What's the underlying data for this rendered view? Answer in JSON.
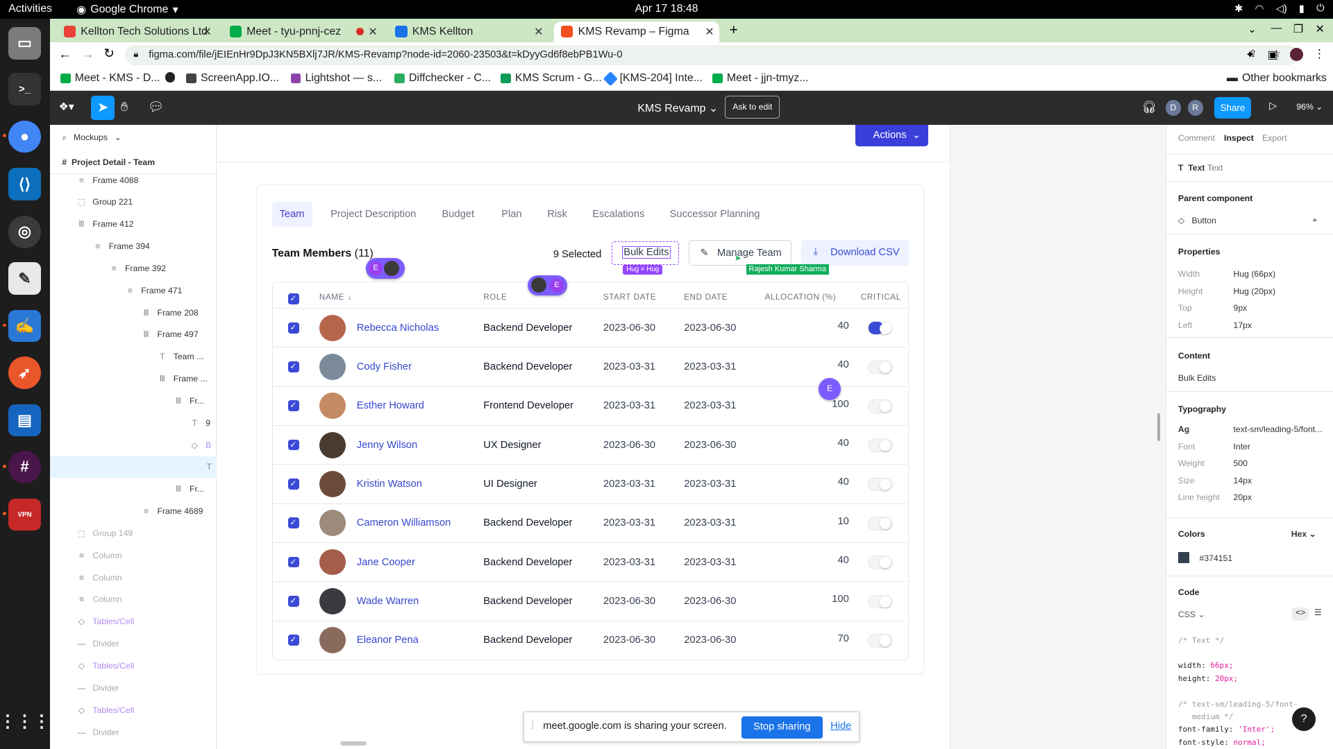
{
  "os": {
    "activities": "Activities",
    "app_name": "Google Chrome",
    "clock": "Apr 17  18:48"
  },
  "chrome": {
    "tabs": [
      {
        "title": "Kellton Tech Solutions Ltd",
        "fav": "#ea4335"
      },
      {
        "title": "Meet - tyu-pnnj-cez",
        "fav": "#00ac47"
      },
      {
        "title": "KMS Kellton",
        "fav": "#1a73e8"
      },
      {
        "title": "KMS Revamp – Figma",
        "fav": "#f24e1e"
      }
    ],
    "url": "figma.com/file/jEIEnHr9DpJ3KN5BXlj7JR/KMS-Revamp?node-id=2060-23503&t=kDyyGd6f8ebPB1Wu-0",
    "bookmarks": [
      {
        "label": "Meet - KMS - D...",
        "color": "#00ac47"
      },
      {
        "label": "",
        "color": "#222"
      },
      {
        "label": "ScreenApp.IO...",
        "color": "#444"
      },
      {
        "label": "Lightshot — s...",
        "color": "#8e44ad"
      },
      {
        "label": "Diffchecker - C...",
        "color": "#27ae60"
      },
      {
        "label": "KMS Scrum - G...",
        "color": "#0f9d58"
      },
      {
        "label": "[KMS-204] Inte...",
        "color": "#2684ff"
      },
      {
        "label": "Meet - jjn-tmyz...",
        "color": "#00ac47"
      }
    ],
    "other_bookmarks": "Other bookmarks"
  },
  "figma": {
    "file_title": "KMS Revamp",
    "ask_to_edit": "Ask to edit",
    "share": "Share",
    "zoom": "96%",
    "avatars": [
      "D",
      "R"
    ],
    "breadcrumb": "Mockups",
    "page": "Project Detail - Team",
    "layers": [
      {
        "label": "Frame 4088",
        "indent": 0,
        "icon": "≡",
        "dim": false
      },
      {
        "label": "Group 221",
        "indent": 0,
        "icon": "⬚",
        "dim": false
      },
      {
        "label": "Frame 412",
        "indent": 0,
        "icon": "Ⅲ",
        "dim": false
      },
      {
        "label": "Frame 394",
        "indent": 1,
        "icon": "≡",
        "dim": false
      },
      {
        "label": "Frame 392",
        "indent": 2,
        "icon": "≡",
        "dim": false
      },
      {
        "label": "Frame 471",
        "indent": 3,
        "icon": "≡",
        "dim": false
      },
      {
        "label": "Frame 208",
        "indent": 4,
        "icon": "Ⅲ",
        "dim": false
      },
      {
        "label": "Frame 497",
        "indent": 4,
        "icon": "Ⅲ",
        "dim": false
      },
      {
        "label": "Team ...",
        "indent": 5,
        "icon": "T",
        "dim": false
      },
      {
        "label": "Frame ...",
        "indent": 5,
        "icon": "Ⅲ",
        "dim": false
      },
      {
        "label": "Fr...",
        "indent": 6,
        "icon": "Ⅲ",
        "dim": false
      },
      {
        "label": "9",
        "indent": 7,
        "icon": "T",
        "dim": false
      },
      {
        "label": "B",
        "indent": 7,
        "icon": "◇",
        "dim": false,
        "purple": true
      },
      {
        "label": "",
        "indent": 8,
        "icon": "T",
        "dim": false,
        "selected": true
      },
      {
        "label": "Fr...",
        "indent": 6,
        "icon": "Ⅲ",
        "dim": false
      },
      {
        "label": "Frame 4689",
        "indent": 4,
        "icon": "≡",
        "dim": false
      },
      {
        "label": "Group 149",
        "indent": 0,
        "icon": "⬚",
        "dim": true
      },
      {
        "label": "Column",
        "indent": 0,
        "icon": "≡",
        "dim": true
      },
      {
        "label": "Column",
        "indent": 0,
        "icon": "≡",
        "dim": true
      },
      {
        "label": "Column",
        "indent": 0,
        "icon": "≡",
        "dim": true
      },
      {
        "label": "Tables/Cell",
        "indent": 0,
        "icon": "◇",
        "dim": true,
        "purple": true
      },
      {
        "label": "Divider",
        "indent": 0,
        "icon": "—",
        "dim": true
      },
      {
        "label": "Tables/Cell",
        "indent": 0,
        "icon": "◇",
        "dim": true,
        "purple": true
      },
      {
        "label": "Divider",
        "indent": 0,
        "icon": "—",
        "dim": true
      },
      {
        "label": "Tables/Cell",
        "indent": 0,
        "icon": "◇",
        "dim": true,
        "purple": true
      },
      {
        "label": "Divider",
        "indent": 0,
        "icon": "—",
        "dim": true
      }
    ]
  },
  "design": {
    "actions": "Actions",
    "tabs": [
      "Team",
      "Project Description",
      "Budget",
      "Plan",
      "Risk",
      "Escalations",
      "Successor Planning"
    ],
    "team_title": "Team Members",
    "team_count": "(11)",
    "selected": "9 Selected",
    "bulk_edits": "Bulk Edits",
    "hug_label": "Hug × Hug",
    "manage_team": "Manage Team",
    "download_csv": "Download CSV",
    "cursor_name": "Rajesh Kumar Sharma",
    "collab_initial": "E",
    "columns": [
      "NAME",
      "ROLE",
      "START DATE",
      "END DATE",
      "ALLOCATION (%)",
      "CRITICAL"
    ],
    "rows": [
      {
        "name": "Rebecca Nicholas",
        "role": "Backend Developer",
        "start": "2023-06-30",
        "end": "2023-06-30",
        "alloc": "40",
        "critical": true,
        "avatar": "#b5654a"
      },
      {
        "name": "Cody Fisher",
        "role": "Backend Developer",
        "start": "2023-03-31",
        "end": "2023-03-31",
        "alloc": "40",
        "critical": false,
        "avatar": "#7a8a99"
      },
      {
        "name": "Esther Howard",
        "role": "Frontend Developer",
        "start": "2023-03-31",
        "end": "2023-03-31",
        "alloc": "100",
        "critical": false,
        "avatar": "#c48a64"
      },
      {
        "name": "Jenny Wilson",
        "role": "UX Designer",
        "start": "2023-06-30",
        "end": "2023-06-30",
        "alloc": "40",
        "critical": false,
        "avatar": "#4a3b30"
      },
      {
        "name": "Kristin Watson",
        "role": "UI Designer",
        "start": "2023-03-31",
        "end": "2023-03-31",
        "alloc": "40",
        "critical": false,
        "avatar": "#6b4a3a"
      },
      {
        "name": "Cameron Williamson",
        "role": "Backend Developer",
        "start": "2023-03-31",
        "end": "2023-03-31",
        "alloc": "10",
        "critical": false,
        "avatar": "#9c8a7a"
      },
      {
        "name": "Jane Cooper",
        "role": "Backend Developer",
        "start": "2023-03-31",
        "end": "2023-03-31",
        "alloc": "40",
        "critical": false,
        "avatar": "#a35d4a"
      },
      {
        "name": "Wade Warren",
        "role": "Backend Developer",
        "start": "2023-06-30",
        "end": "2023-06-30",
        "alloc": "100",
        "critical": false,
        "avatar": "#3b3a40"
      },
      {
        "name": "Eleanor Pena",
        "role": "Backend Developer",
        "start": "2023-06-30",
        "end": "2023-06-30",
        "alloc": "70",
        "critical": false,
        "avatar": "#8a6a5c"
      }
    ]
  },
  "inspect": {
    "tabs": [
      "Comment",
      "Inspect",
      "Export"
    ],
    "layer_type": "Text",
    "layer_name": "Text",
    "parent_component_h": "Parent component",
    "parent_component": "Button",
    "properties_h": "Properties",
    "props": [
      {
        "k": "Width",
        "v": "Hug (66px)"
      },
      {
        "k": "Height",
        "v": "Hug (20px)"
      },
      {
        "k": "Top",
        "v": "9px"
      },
      {
        "k": "Left",
        "v": "17px"
      }
    ],
    "content_h": "Content",
    "content": "Bulk Edits",
    "typography_h": "Typography",
    "typo": [
      {
        "k": "Ag",
        "v": "text-sm/leading-5/font..."
      },
      {
        "k": "Font",
        "v": "Inter"
      },
      {
        "k": "Weight",
        "v": "500"
      },
      {
        "k": "Size",
        "v": "14px"
      },
      {
        "k": "Line height",
        "v": "20px"
      }
    ],
    "colors_h": "Colors",
    "color_format": "Hex",
    "color_value": "#374151",
    "code_h": "Code",
    "code_lang": "CSS",
    "code_lines": [
      "/* Text */",
      "",
      "width: 66px;",
      "height: 20px;",
      "",
      "/* text-sm/leading-5/font-",
      "   medium */",
      "font-family: 'Inter';",
      "font-style: normal;"
    ]
  },
  "meet_share": {
    "message": "meet.google.com is sharing your screen.",
    "stop": "Stop sharing",
    "hide": "Hide"
  }
}
